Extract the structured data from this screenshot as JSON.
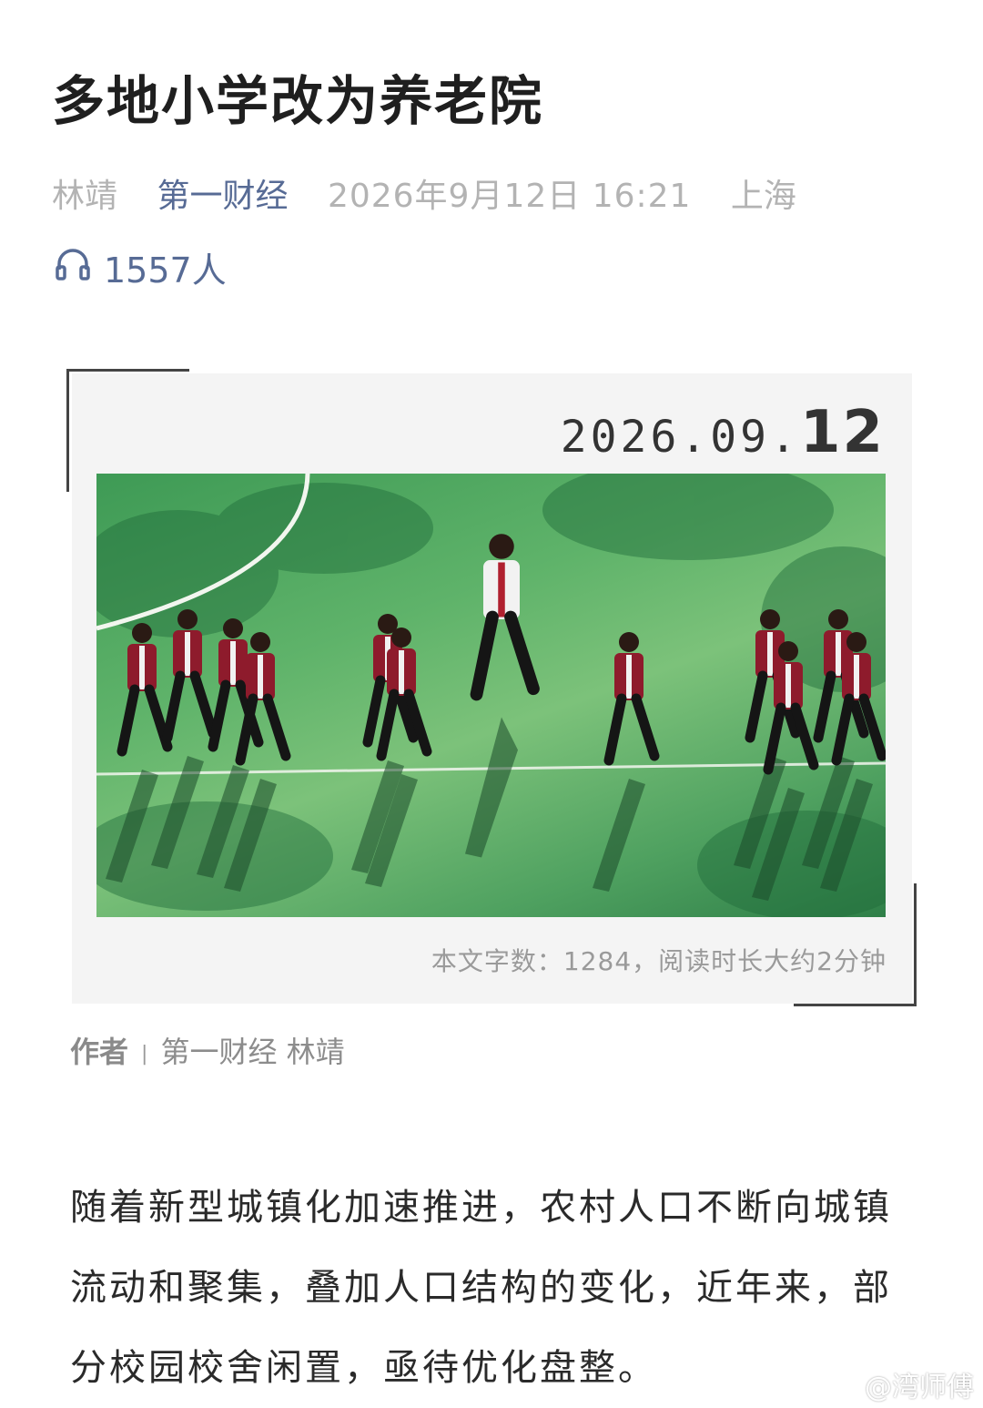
{
  "article": {
    "title": "多地小学改为养老院",
    "author": "林靖",
    "source": "第一财经",
    "datetime": "2026年9月12日 16:21",
    "location": "上海",
    "listeners": "1557人"
  },
  "card": {
    "date_prefix": "2026.09.",
    "date_day": "12",
    "word_count": "本文字数：1284，阅读时长大约2分钟"
  },
  "byline": {
    "label": "作者",
    "separator": "|",
    "text": "第一财经 林靖"
  },
  "body": {
    "paragraph": "随着新型城镇化加速推进，农村人口不断向城镇流动和聚集，叠加人口结构的变化，近年来，部分校园校舍闲置，亟待优化盘整。"
  },
  "watermark": {
    "text": "@湾师傅"
  },
  "colors": {
    "link": "#576b95",
    "meta": "#b3b3b3",
    "card_bg": "#f4f4f4"
  }
}
